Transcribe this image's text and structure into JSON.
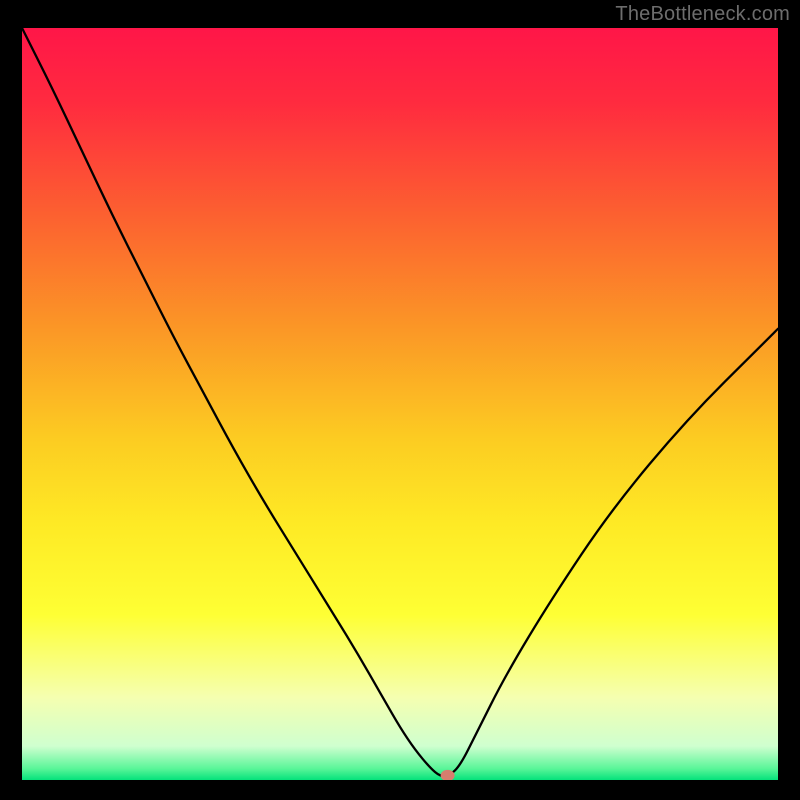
{
  "watermark": "TheBottleneck.com",
  "chart_data": {
    "type": "line",
    "title": "",
    "xlabel": "",
    "ylabel": "",
    "xlim": [
      0,
      100
    ],
    "ylim": [
      0,
      100
    ],
    "background_gradient": {
      "stops": [
        {
          "offset": 0.0,
          "color": "#ff1648"
        },
        {
          "offset": 0.1,
          "color": "#ff2b3f"
        },
        {
          "offset": 0.25,
          "color": "#fc6130"
        },
        {
          "offset": 0.4,
          "color": "#fb9726"
        },
        {
          "offset": 0.55,
          "color": "#fccd22"
        },
        {
          "offset": 0.66,
          "color": "#feea25"
        },
        {
          "offset": 0.78,
          "color": "#feff34"
        },
        {
          "offset": 0.89,
          "color": "#f5ffb0"
        },
        {
          "offset": 0.955,
          "color": "#cfffcf"
        },
        {
          "offset": 0.985,
          "color": "#59f598"
        },
        {
          "offset": 1.0,
          "color": "#04e27b"
        }
      ]
    },
    "series": [
      {
        "name": "bottleneck-curve",
        "stroke": "#000000",
        "stroke_width": 2.3,
        "x": [
          0,
          4,
          8,
          12,
          16,
          20,
          24,
          28,
          32,
          36,
          40,
          44,
          48,
          50,
          52,
          54,
          55.3,
          56.5,
          58,
          60,
          64,
          70,
          78,
          88,
          98,
          100
        ],
        "y": [
          100,
          92,
          83.5,
          75,
          67,
          59,
          51.5,
          44,
          37,
          30.5,
          24,
          17.5,
          10.5,
          7,
          4,
          1.6,
          0.5,
          0.5,
          2,
          6,
          14,
          24,
          36,
          48,
          58,
          60
        ]
      }
    ],
    "marker": {
      "name": "bottleneck-marker",
      "x": 56.3,
      "y": 0.6,
      "rx": 7,
      "ry": 5.6,
      "fill": "#d67e6e"
    }
  }
}
